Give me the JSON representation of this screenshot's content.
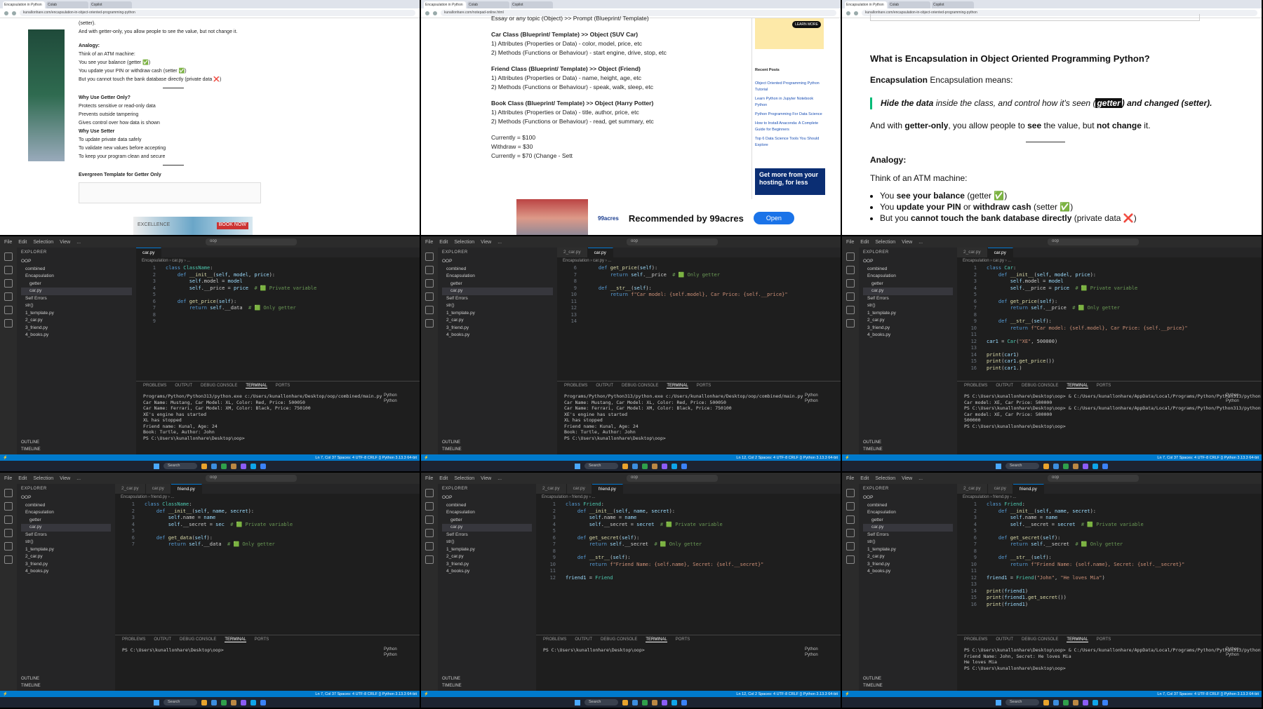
{
  "browser1": {
    "tabs": [
      "Encapsulation in Python",
      "Colab",
      "Copilot"
    ],
    "url": "kunallonhare.com/encapsulation-in-object-oriented-programming-python",
    "text": {
      "setter": "(setter).",
      "getter_only": "And with getter-only, you allow people to see the value, but not change it.",
      "analogy": "Analogy:",
      "think": "Think of an ATM machine:",
      "b1": "You see your balance (getter ✅)",
      "b2": "You update your PIN or withdraw cash (setter ✅)",
      "b3": "But you cannot touch the bank database directly (private data ❌)",
      "why_getter_only": "Why Use Getter Only?",
      "w1": "Protects sensitive or read-only data",
      "w2": "Prevents outside tampering",
      "w3": "Gives control over how data is shown",
      "why_setter": "Why Use Setter",
      "s1": "To update private data safely",
      "s2": "To validate new values before accepting",
      "s3": "To keep your program clean and secure",
      "evergreen": "Evergreen Template for Getter Only",
      "ad_excellence": "EXCELLENCE",
      "ad_book": "BOOK NOW"
    }
  },
  "browser2": {
    "url": "kunallonhare.com/notepad-online.html",
    "essay": "Essay or any topic (Object) >> Prompt (Blueprint/ Template)",
    "car_title": "Car Class (Blueprint/ Template) >> Object (SUV Car)",
    "car1": "1) Attributes (Properties or Data) - color, model, price, etc",
    "car2": "2) Methods (Functions or Behaviour) - start engine, drive, stop, etc",
    "friend_title": "Friend Class (Blueprint/ Template) >> Object (Friend)",
    "friend1": "1) Attributes (Properties or Data) - name, height, age, etc",
    "friend2": "2) Methods (Functions or Behaviour) - speak, walk, sleep, etc",
    "book_title": "Book Class (Blueprint/ Template) >> Object (Harry Potter)",
    "book1": "1) Attributes (Properties or Data) - title, author, price, etc",
    "book2": "2) Methods (Functions or Behaviour) - read, get summary, etc",
    "c1": "Currently = $100",
    "c2": "Withdraw = $30",
    "c3": "Currently = $70 (Change - Sett",
    "learn_more": "LEARN MORE",
    "recent_posts": "Recent Posts",
    "posts": [
      "Object Oriented Programming Python Tutorial",
      "Learn Python in Jupyter Notebook Python",
      "Python Programming For Data Science",
      "How to Install Anaconda: A Complete Guide for Beginners",
      "Top 6 Data Science Tools You Should Explore"
    ],
    "hosting": "Get more from your hosting, for less",
    "ad_brand": "99acres",
    "ad_text": "Recommended by 99acres",
    "ad_btn": "Open"
  },
  "browser3": {
    "heading": "What is Encapsulation in Object Oriented Programming Python?",
    "means": "Encapsulation means:",
    "quote_a": "Hide the data",
    "quote_b": " inside the class, and control how it's seen (",
    "quote_getter": "getter",
    "quote_c": ") and changed (setter).",
    "getter_only_a": "And with ",
    "getter_only_b": "getter-only",
    "getter_only_c": ", you allow people to ",
    "getter_only_d": "see",
    "getter_only_e": " the value, but ",
    "getter_only_f": "not change",
    "getter_only_g": " it.",
    "analogy": "Analogy:",
    "think": "Think of an ATM machine:",
    "b1a": "You ",
    "b1b": "see your balance",
    "b1c": " (getter ✅)",
    "b2a": "You ",
    "b2b": "update your PIN",
    "b2c": " or ",
    "b2d": "withdraw cash",
    "b2e": " (setter ✅)",
    "b3a": "But you ",
    "b3b": "cannot touch the bank database directly",
    "b3c": " (private data ❌)"
  },
  "vs": {
    "menu": [
      "File",
      "Edit",
      "Selection",
      "View",
      "..."
    ],
    "search": "oop",
    "explorer": "EXPLORER",
    "tree": [
      "OOP",
      "combined",
      "Encapsulation",
      "getter",
      "car.py",
      "Self Errors",
      "str()",
      "1_template.py",
      "2_car.py",
      "3_friend.py",
      "4_books.py"
    ],
    "outline": "OUTLINE",
    "timeline": "TIMELINE",
    "term_tabs": [
      "PROBLEMS",
      "OUTPUT",
      "DEBUG CONSOLE",
      "TERMINAL",
      "PORTS"
    ],
    "term_panel": [
      "Python",
      "Python"
    ],
    "status_a": "Ln 7, Col 37   Spaces: 4   UTF-8   CRLF   {} Python   3.13.3 64-bit",
    "status_b": "Ln 12, Col 2   Spaces: 4   UTF-8   CRLF   {} Python   3.13.3 64-bit",
    "taskbar_search": "Search",
    "term_out": "Programs/Python/Python313/python.exe c:/Users/kunallonhare/Desktop/oop/combined/main.py\nCar Name: Mustang, Car Model: XL, Color: Red, Price: 500050\nCar Name: Ferrari, Car Model: XM, Color: Black, Price: 750100\nXE's engine has started\nXL has stopped\nFriend name: Kunal, Age: 24\nBook: Turtle, Author: John\nPS C:\\Users\\kunallonhare\\Desktop\\oop> ",
    "term_out3": "PS C:\\Users\\kunallonhare\\Desktop\\oop> & C:/Users/kunallonhare/AppData/Local/Programs/Python/Python313/python.exe c:/Users/kunallonhare/Desktop/oop/Encapsulation/car.py\nCar model: XE, Car Price: 500000\nPS C:\\Users\\kunallonhare\\Desktop\\oop> & C:/Users/kunallonhare/AppData/Local/Programs/Python/Python313/python.exe c:/Users/kunallonhare/Desktop/oop/Encapsulation/car.py\nCar model: XE, Car Price: 500000\n500000\nPS C:\\Users\\kunallonhare\\Desktop\\oop> ",
    "term_prompt": "PS C:\\Users\\kunallonhare\\Desktop\\oop> ",
    "term_out6": "PS C:\\Users\\kunallonhare\\Desktop\\oop> & C:/Users/kunallonhare/AppData/Local/Programs/Python/Python313/python.exe c:/Users/kunallonhare/Desktop/oop/Encapsulation/friend.py\nFriend Name: John, Secret: He loves Mia\nHe loves Mia\nPS C:\\Users\\kunallonhare\\Desktop\\oop> "
  }
}
